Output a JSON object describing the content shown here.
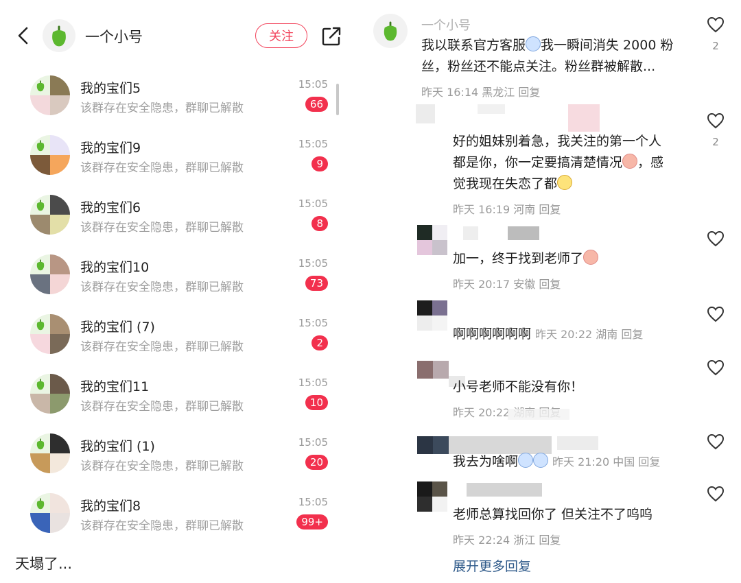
{
  "left": {
    "profile": {
      "name": "一个小号",
      "follow_label": "关注"
    },
    "groups": [
      {
        "name": "我的宝们5",
        "subtitle": "该群存在安全隐患，群聊已解散",
        "time": "15:05",
        "badge": "66"
      },
      {
        "name": "我的宝们9",
        "subtitle": "该群存在安全隐患，群聊已解散",
        "time": "15:05",
        "badge": "9"
      },
      {
        "name": "我的宝们6",
        "subtitle": "该群存在安全隐患，群聊已解散",
        "time": "15:05",
        "badge": "8"
      },
      {
        "name": "我的宝们10",
        "subtitle": "该群存在安全隐患，群聊已解散",
        "time": "15:05",
        "badge": "73"
      },
      {
        "name": "我的宝们 (7)",
        "subtitle": "该群存在安全隐患，群聊已解散",
        "time": "15:05",
        "badge": "2"
      },
      {
        "name": "我的宝们11",
        "subtitle": "该群存在安全隐患，群聊已解散",
        "time": "15:05",
        "badge": "10"
      },
      {
        "name": "我的宝们 (1)",
        "subtitle": "该群存在安全隐患，群聊已解散",
        "time": "15:05",
        "badge": "20"
      },
      {
        "name": "我的宝们8",
        "subtitle": "该群存在安全隐患，群聊已解散",
        "time": "15:05",
        "badge": "99+"
      }
    ],
    "caption": "天塌了..."
  },
  "right": {
    "comments": [
      {
        "author": "一个小号",
        "text_line1": "我以联系官方客服",
        "text_line1b": "我一瞬间消失 2000 粉",
        "text_line2": "丝，粉丝还不能点关注。粉丝群被解散...",
        "meta": "昨天 16:14 黑龙江 回复",
        "likes": "2"
      },
      {
        "text_line1": "好的姐妹别着急，我关注的第一个人",
        "text_line2a": "都是你，你一定要搞清楚情况",
        "text_line2b": "，感",
        "text_line3": "觉我现在失恋了都",
        "meta": "昨天 16:19 河南 回复",
        "likes": "2"
      },
      {
        "text": "加一，终于找到老师了",
        "meta": "昨天 20:17 安徽 回复"
      },
      {
        "text": "啊啊啊啊啊啊",
        "meta_inline": "昨天 20:22 湖南 回复"
      },
      {
        "text": "小号老师不能没有你！",
        "meta": "昨天 20:22 湖南 回复"
      },
      {
        "text": "我去为啥啊",
        "meta_inline": "昨天 21:20 中国 回复"
      },
      {
        "text": "老师总算找回你了 但关注不了呜呜",
        "meta": "昨天 22:24 浙江 回复"
      }
    ],
    "more_replies": "展开更多回复"
  },
  "colors": {
    "accent": "#f2435b",
    "badge": "#f2304d",
    "link": "#2f5a8a",
    "muted": "#9a9a9a"
  },
  "icons": [
    "chevron-left-icon",
    "share-icon",
    "heart-outline-icon",
    "green-pepper-icon"
  ]
}
